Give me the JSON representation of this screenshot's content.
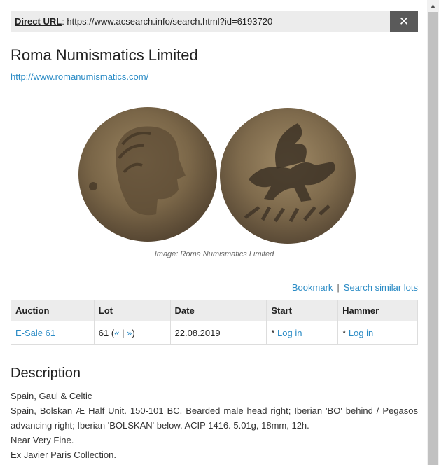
{
  "url_bar": {
    "label": "Direct URL",
    "url": "https://www.acsearch.info/search.html?id=6193720",
    "close": "✕"
  },
  "header": {
    "title": "Roma Numismatics Limited",
    "link": "http://www.romanumismatics.com/"
  },
  "image": {
    "caption": "Image: Roma Numismatics Limited"
  },
  "actions": {
    "bookmark": "Bookmark",
    "separator": "|",
    "similar": "Search similar lots"
  },
  "table": {
    "headers": [
      "Auction",
      "Lot",
      "Date",
      "Start",
      "Hammer"
    ],
    "row": {
      "auction": "E-Sale 61",
      "lot_number": "61",
      "lot_open": "(",
      "prev": "«",
      "lot_sep": "|",
      "next": "»",
      "lot_close": ")",
      "date": "22.08.2019",
      "start_star": "*",
      "start_link": "Log in",
      "hammer_star": "*",
      "hammer_link": "Log in"
    }
  },
  "description": {
    "title": "Description",
    "lines": [
      "Spain, Gaul & Celtic",
      "Spain, Bolskan Æ Half Unit. 150-101 BC. Bearded male head right; Iberian 'BO' behind / Pegasos advancing right; Iberian 'BOLSKAN' below. ACIP 1416. 5.01g, 18mm, 12h.",
      "Near Very Fine.",
      "Ex Javier Paris Collection."
    ]
  },
  "scrollbar": {
    "up_arrow": "▲"
  }
}
